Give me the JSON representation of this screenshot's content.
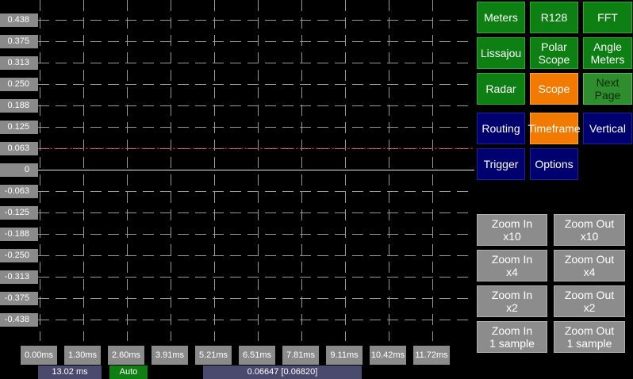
{
  "y_axis": {
    "labels": [
      "0.438",
      "0.375",
      "0.313",
      "0.250",
      "0.188",
      "0.125",
      "0.063",
      "0",
      "-0.063",
      "-0.125",
      "-0.188",
      "-0.250",
      "-0.313",
      "-0.375",
      "-0.438"
    ]
  },
  "x_axis": {
    "labels": [
      "0.00ms",
      "1.30ms",
      "2.60ms",
      "3.91ms",
      "5.21ms",
      "6.51ms",
      "7.81ms",
      "9.11ms",
      "10.42ms",
      "11.72ms"
    ]
  },
  "status_bar": {
    "timespan": "13.02 ms",
    "mode": "Auto",
    "trigger_value": "0.06647 [0.06820]"
  },
  "trace": {
    "signal_level": 0,
    "trigger_level": 0.063
  },
  "colors": {
    "green": "#0e7f13",
    "orange": "#f27a00",
    "blue": "#00006e",
    "gray": "#8c8c8c",
    "trigger_line": "#c04040"
  },
  "view_buttons": {
    "meters": "Meters",
    "r128": "R128",
    "fft": "FFT",
    "lissajou": "Lissajou",
    "polar_scope": "Polar\nScope",
    "angle_meters": "Angle\nMeters",
    "radar": "Radar",
    "scope": "Scope",
    "next_page": "Next\nPage"
  },
  "scope_buttons": {
    "routing": "Routing",
    "timeframe": "Timeframe",
    "vertical": "Vertical",
    "trigger": "Trigger",
    "options": "Options"
  },
  "zoom_buttons": {
    "zoom_in_x10": "Zoom In\nx10",
    "zoom_out_x10": "Zoom Out\nx10",
    "zoom_in_x4": "Zoom In\nx4",
    "zoom_out_x4": "Zoom Out\nx4",
    "zoom_in_x2": "Zoom In\nx2",
    "zoom_out_x2": "Zoom Out\nx2",
    "zoom_in_1": "Zoom In\n1 sample",
    "zoom_out_1": "Zoom Out\n1 sample"
  }
}
